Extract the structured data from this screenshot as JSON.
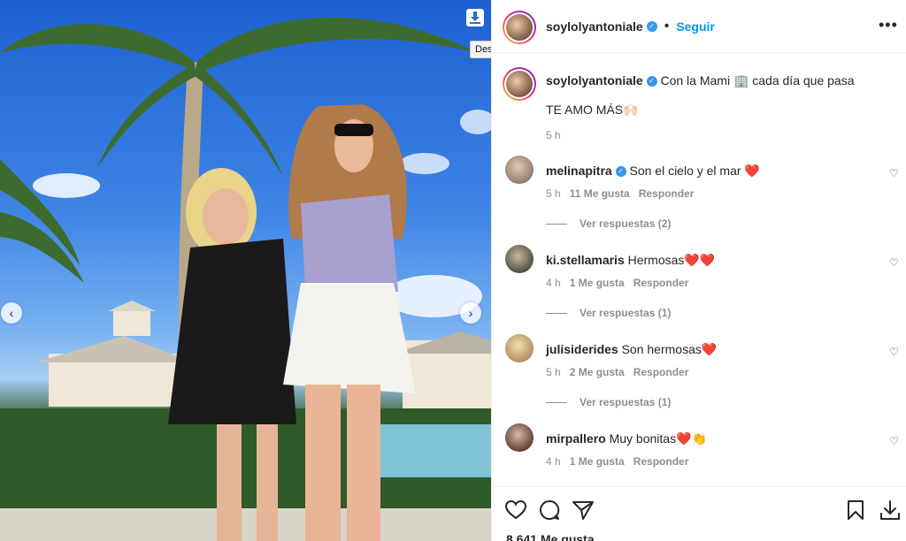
{
  "photo": {
    "download_tooltip": "Descargar",
    "prev_icon": "chevron-left-icon",
    "next_icon": "chevron-right-icon",
    "download_icon": "download-icon"
  },
  "post": {
    "username": "soylolyantoniale",
    "follow_label": "Seguir",
    "separator": "•",
    "caption_text": "Con la Mami 🏢 cada día que pasa",
    "caption_line2": "TE AMO MÁS🙌🏻",
    "time": "5 h"
  },
  "comments": [
    {
      "user": "melinapitra",
      "verified": true,
      "text": "Son el cielo y el mar ❤️",
      "time": "5 h",
      "likes": "11 Me gusta",
      "reply": "Responder",
      "view_replies": "Ver respuestas (2)"
    },
    {
      "user": "ki.stellamaris",
      "verified": false,
      "text": "Hermosas❤️❤️",
      "time": "4 h",
      "likes": "1 Me gusta",
      "reply": "Responder",
      "view_replies": "Ver respuestas (1)"
    },
    {
      "user": "julisiderides",
      "verified": false,
      "text": "Son hermosas❤️",
      "time": "5 h",
      "likes": "2 Me gusta",
      "reply": "Responder",
      "view_replies": "Ver respuestas (1)"
    },
    {
      "user": "mirpallero",
      "verified": false,
      "text": "Muy bonitas❤️👏",
      "time": "4 h",
      "likes": "1 Me gusta",
      "reply": "Responder"
    }
  ],
  "footer": {
    "likes_count": "8.641 Me gusta"
  },
  "colors": {
    "accent": "#0095f6",
    "verified": "#3897f0",
    "muted": "#8e8e8e"
  }
}
